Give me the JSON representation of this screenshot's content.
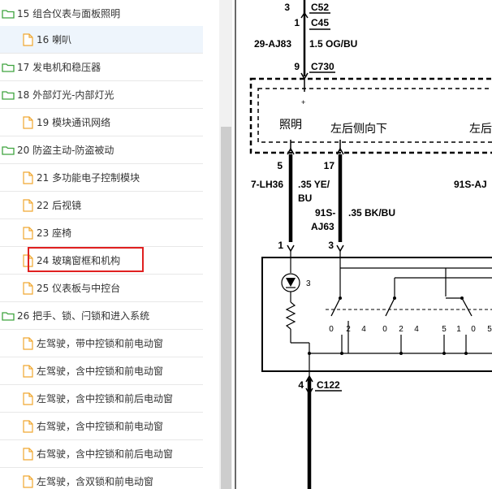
{
  "tree": {
    "items": [
      {
        "label": "15 组合仪表与面板照明",
        "kind": "folder"
      },
      {
        "label": "16 喇叭",
        "kind": "file",
        "selected": true
      },
      {
        "label": "17 发电机和稳压器",
        "kind": "folder"
      },
      {
        "label": "18 外部灯光-内部灯光",
        "kind": "folder"
      },
      {
        "label": "19 模块通讯网络",
        "kind": "file"
      },
      {
        "label": "20 防盗主动-防盗被动",
        "kind": "folder"
      },
      {
        "label": "21 多功能电子控制模块",
        "kind": "file"
      },
      {
        "label": "22 后视镜",
        "kind": "file"
      },
      {
        "label": "23 座椅",
        "kind": "file"
      },
      {
        "label": "24 玻璃窗框和机构",
        "kind": "file",
        "highlighted": true
      },
      {
        "label": "25 仪表板与中控台",
        "kind": "file"
      },
      {
        "label": "26 把手、锁、闩锁和进入系统",
        "kind": "folder"
      },
      {
        "label": "左驾驶，带中控锁和前电动窗",
        "kind": "file"
      },
      {
        "label": "左驾驶，含中控锁和前电动窗",
        "kind": "file"
      },
      {
        "label": "左驾驶，含中控锁和前后电动窗",
        "kind": "file"
      },
      {
        "label": "右驾驶，含中控锁和前电动窗",
        "kind": "file"
      },
      {
        "label": "右驾驶，含中控锁和前后电动窗",
        "kind": "file"
      },
      {
        "label": "左驾驶，含双锁和前电动窗",
        "kind": "file"
      }
    ]
  },
  "diagram": {
    "pin_top_3": "3",
    "conn_c52": "C52",
    "pin_1": "1",
    "conn_c45": "C45",
    "wire_29aj83": "29-AJ83",
    "wire_spec_1": "1.5 OG/BU",
    "pin_9": "9",
    "conn_c730": "C730",
    "plus_sign": "+",
    "label_illum": "照明",
    "label_left_rear_1": "左后侧向下",
    "label_left_rear_2": "左后",
    "pin_5": "5",
    "pin_17": "17",
    "wire_7lh36": "7-LH36",
    "wire_spec_35ye": ".35 YE/",
    "wire_spec_bu": "BU",
    "wire_91s_a": "91S-",
    "wire_aj63": "AJ63",
    "wire_spec_35bk": ".35 BK/BU",
    "wire_91saj": "91S-AJ",
    "pin_1b": "1",
    "pin_3b": "3",
    "lamp_num": "3",
    "sw1_pos": [
      "0",
      "2",
      "4"
    ],
    "sw2_pos": [
      "0",
      "2",
      "4"
    ],
    "sw3_pos": [
      "5",
      "1",
      "0",
      "5"
    ],
    "pin_4": "4",
    "conn_c122": "C122"
  },
  "colors": {
    "highlight_border": "#e02020",
    "selected_bg": "#eef5fc",
    "folder_icon": "#3fa33f",
    "file_icon": "#f0a830"
  }
}
